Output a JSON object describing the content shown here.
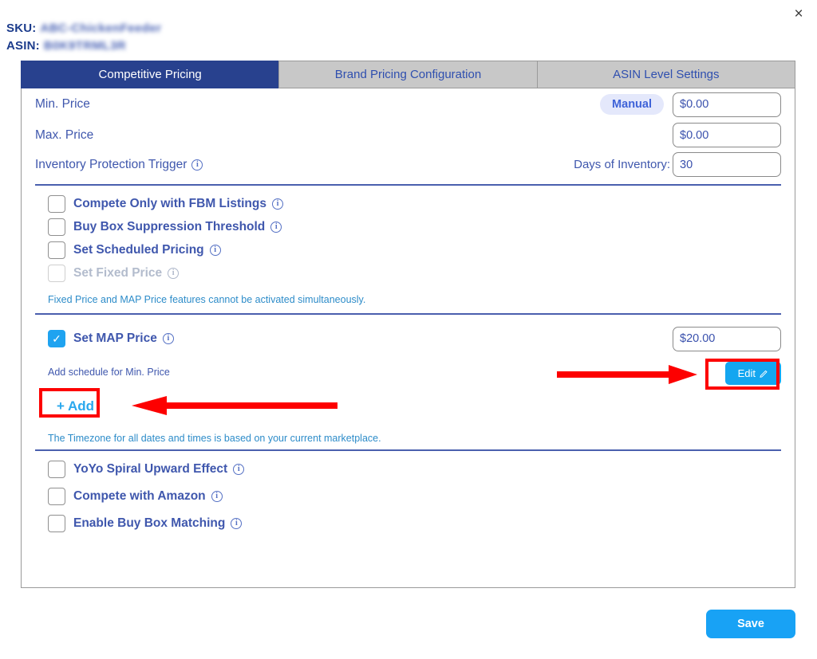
{
  "window": {
    "close_label": "×"
  },
  "identifiers": {
    "sku_label": "SKU:",
    "sku_value": "ABC-ChickenFeeder",
    "asin_label": "ASIN:",
    "asin_value": "B0K9TRML3R"
  },
  "tabs": [
    {
      "label": "Competitive Pricing",
      "active": true
    },
    {
      "label": "Brand Pricing Configuration",
      "active": false
    },
    {
      "label": "ASIN Level Settings",
      "active": false
    }
  ],
  "pricing": {
    "min_price_label": "Min. Price",
    "min_price_mode": "Manual",
    "min_price_value": "$0.00",
    "max_price_label": "Max. Price",
    "max_price_value": "$0.00",
    "inventory_trigger_label": "Inventory Protection Trigger",
    "days_of_inventory_label": "Days of Inventory:",
    "days_of_inventory_value": "30"
  },
  "options_top": [
    {
      "label": "Compete Only with FBM Listings",
      "checked": false,
      "disabled": false
    },
    {
      "label": "Buy Box Suppression Threshold",
      "checked": false,
      "disabled": false
    },
    {
      "label": "Set Scheduled Pricing",
      "checked": false,
      "disabled": false
    },
    {
      "label": "Set Fixed Price",
      "checked": false,
      "disabled": true
    }
  ],
  "fixed_price_note": "Fixed Price and MAP Price features cannot be activated simultaneously.",
  "map": {
    "label": "Set MAP Price",
    "checked": true,
    "value": "$20.00",
    "schedule_label": "Add schedule for Min. Price",
    "add_label": "+ Add",
    "edit_label": "Edit",
    "edit_icon": "pencil-icon"
  },
  "timezone_note": "The Timezone for all dates and times is based on your current marketplace.",
  "options_bottom": [
    {
      "label": "YoYo Spiral Upward Effect",
      "checked": false
    },
    {
      "label": "Compete with Amazon",
      "checked": false
    },
    {
      "label": "Enable Buy Box Matching",
      "checked": false
    }
  ],
  "footer": {
    "save_label": "Save"
  },
  "colors": {
    "tab_active_bg": "#28418e",
    "tab_inactive_bg": "#c8c8c8",
    "label_blue": "#3f57ad",
    "note_blue": "#2d8cc9",
    "accent_blue": "#18a2f5",
    "annotation_red": "#fd0000",
    "pill_bg": "#e4e8fb"
  },
  "icons": {
    "info": "ⓘ",
    "check": "✓"
  }
}
